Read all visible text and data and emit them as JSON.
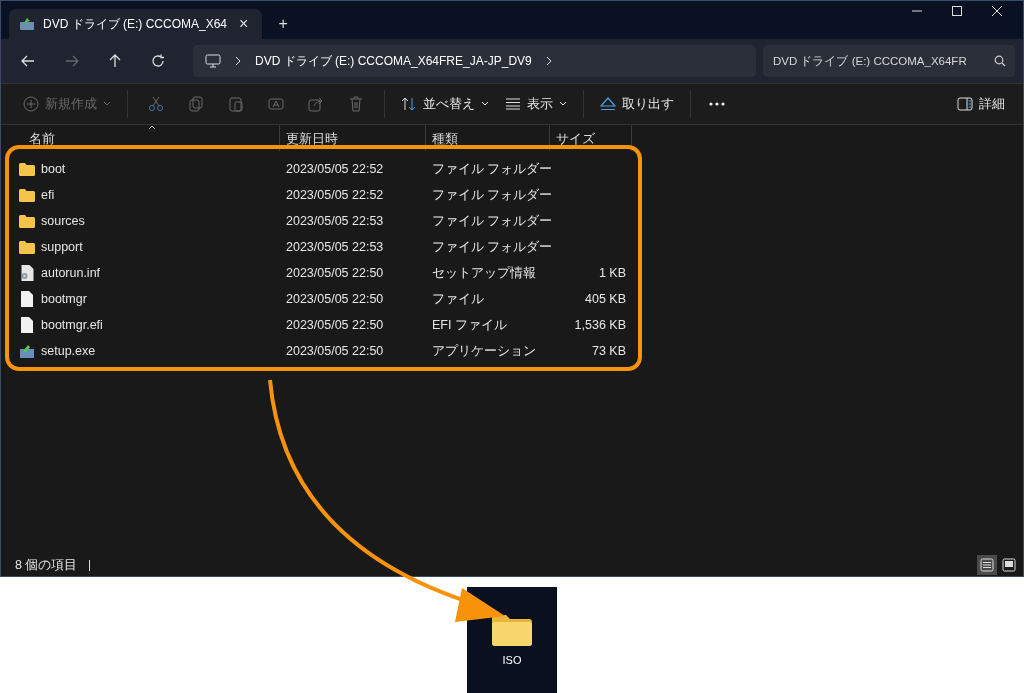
{
  "window": {
    "tab": {
      "title": "DVD ドライブ (E:) CCCOMA_X64",
      "close": "×"
    },
    "new_tab": "+"
  },
  "address": {
    "path": "DVD ドライブ (E:) CCCOMA_X64FRE_JA-JP_DV9"
  },
  "search": {
    "placeholder": "DVD ドライブ (E:) CCCOMA_X64FR"
  },
  "toolbar": {
    "new": {
      "label": "新規作成",
      "disabled": true
    },
    "icon_buttons": [
      {
        "disabled": true
      },
      {
        "disabled": true
      },
      {
        "disabled": true
      },
      {
        "disabled": true
      },
      {
        "disabled": true
      },
      {
        "disabled": true
      }
    ],
    "sort": {
      "label": "並べ替え"
    },
    "view": {
      "label": "表示"
    },
    "eject": {
      "label": "取り出す"
    },
    "details": {
      "label": "詳細"
    }
  },
  "table": {
    "columns": [
      "名前",
      "更新日時",
      "種類",
      "サイズ"
    ],
    "rows": [
      {
        "kind": "folder",
        "name": "boot",
        "modified": "2023/05/05 22:52",
        "type": "ファイル フォルダー",
        "size": ""
      },
      {
        "kind": "folder",
        "name": "efi",
        "modified": "2023/05/05 22:52",
        "type": "ファイル フォルダー",
        "size": ""
      },
      {
        "kind": "folder",
        "name": "sources",
        "modified": "2023/05/05 22:53",
        "type": "ファイル フォルダー",
        "size": ""
      },
      {
        "kind": "folder",
        "name": "support",
        "modified": "2023/05/05 22:53",
        "type": "ファイル フォルダー",
        "size": ""
      },
      {
        "kind": "settings",
        "name": "autorun.inf",
        "modified": "2023/05/05 22:50",
        "type": "セットアップ情報",
        "size": "1 KB"
      },
      {
        "kind": "file",
        "name": "bootmgr",
        "modified": "2023/05/05 22:50",
        "type": "ファイル",
        "size": "405 KB"
      },
      {
        "kind": "file",
        "name": "bootmgr.efi",
        "modified": "2023/05/05 22:50",
        "type": "EFI ファイル",
        "size": "1,536 KB"
      },
      {
        "kind": "app",
        "name": "setup.exe",
        "modified": "2023/05/05 22:50",
        "type": "アプリケーション",
        "size": "73 KB"
      }
    ]
  },
  "status_bar": {
    "count": "8 個の項目",
    "views": [
      {
        "selected": true
      },
      {
        "selected": false
      }
    ]
  },
  "desktop": {
    "icon_label": "ISO"
  }
}
